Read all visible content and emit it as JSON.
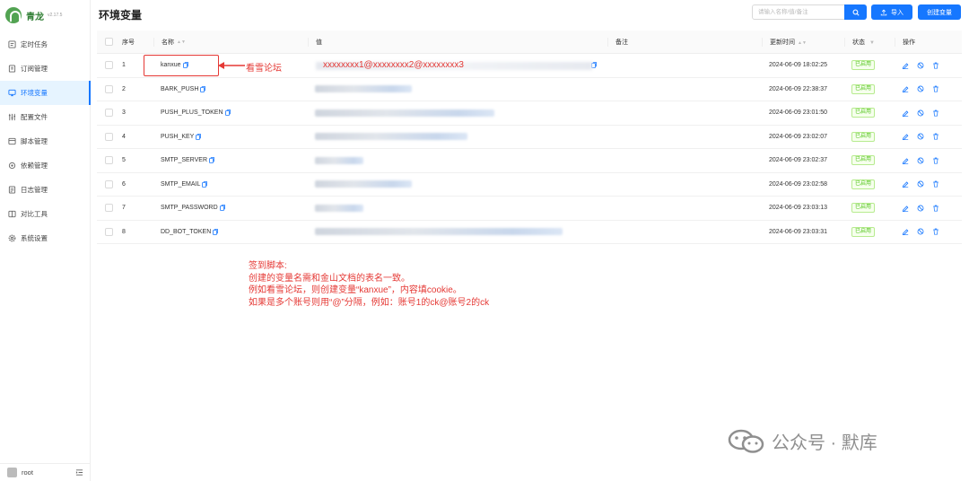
{
  "app": {
    "name": "青龙",
    "version": "v2.17.5"
  },
  "sidebar": {
    "items": [
      {
        "label": "定时任务",
        "icon": "clock-icon"
      },
      {
        "label": "订阅管理",
        "icon": "subscription-icon"
      },
      {
        "label": "环境变量",
        "icon": "monitor-icon",
        "active": true
      },
      {
        "label": "配置文件",
        "icon": "sliders-icon"
      },
      {
        "label": "脚本管理",
        "icon": "script-icon"
      },
      {
        "label": "依赖管理",
        "icon": "gear-icon"
      },
      {
        "label": "日志管理",
        "icon": "log-icon"
      },
      {
        "label": "对比工具",
        "icon": "diff-icon"
      },
      {
        "label": "系统设置",
        "icon": "settings-icon"
      }
    ]
  },
  "user": {
    "name": "root"
  },
  "header": {
    "title": "环境变量",
    "search_placeholder": "请输入名称/值/备注",
    "import_label": "导入",
    "create_label": "创建变量"
  },
  "table": {
    "columns": {
      "no": "序号",
      "name": "名称",
      "value": "值",
      "note": "备注",
      "time": "更新时间",
      "status": "状态",
      "ops": "操作"
    },
    "rows": [
      {
        "no": "1",
        "name": "kanxue",
        "time": "2024-06-09 18:02:25",
        "status": "已启用"
      },
      {
        "no": "2",
        "name": "BARK_PUSH",
        "time": "2024-06-09 22:38:37",
        "status": "已启用"
      },
      {
        "no": "3",
        "name": "PUSH_PLUS_TOKEN",
        "time": "2024-06-09 23:01:50",
        "status": "已启用"
      },
      {
        "no": "4",
        "name": "PUSH_KEY",
        "time": "2024-06-09 23:02:07",
        "status": "已启用"
      },
      {
        "no": "5",
        "name": "SMTP_SERVER",
        "time": "2024-06-09 23:02:37",
        "status": "已启用"
      },
      {
        "no": "6",
        "name": "SMTP_EMAIL",
        "time": "2024-06-09 23:02:58",
        "status": "已启用"
      },
      {
        "no": "7",
        "name": "SMTP_PASSWORD",
        "time": "2024-06-09 23:03:13",
        "status": "已启用"
      },
      {
        "no": "8",
        "name": "DD_BOT_TOKEN",
        "time": "2024-06-09 23:03:31",
        "status": "已启用"
      }
    ]
  },
  "annotations": {
    "arrow_label": "看雪论坛",
    "value_example": "xxxxxxxx1@xxxxxxxx2@xxxxxxxx3",
    "note_lines": [
      "签到脚本:",
      "创建的变量名需和金山文档的表名一致。",
      "例如看雪论坛，则创建变量“kanxue”，内容填cookie。",
      "如果是多个账号则用“@”分隔，例如：账号1的ck@账号2的ck"
    ]
  },
  "watermark": {
    "text": "公众号 · 默库"
  },
  "colors": {
    "primary": "#1677ff",
    "annotation": "#e53935",
    "success": "#52c41a",
    "brand": "#2e7d32"
  }
}
